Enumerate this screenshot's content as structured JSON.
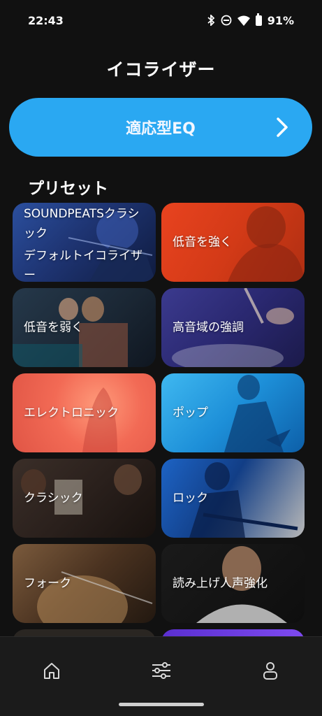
{
  "status_bar": {
    "time": "22:43",
    "battery": "91%",
    "icons": [
      "bluetooth-icon",
      "do-not-disturb-icon",
      "wifi-icon",
      "battery-icon"
    ]
  },
  "header": {
    "title": "イコライザー"
  },
  "adaptive_eq": {
    "label": "適応型EQ",
    "icon": "chevron-right-icon",
    "color": "#2aa8f2"
  },
  "presets": {
    "title": "プリセット",
    "items": [
      {
        "label": "SOUNDPEATSクラシック",
        "sub": "デフォルトイコライザー"
      },
      {
        "label": "低音を強く"
      },
      {
        "label": "低音を弱く"
      },
      {
        "label": "高音域の強調"
      },
      {
        "label": "エレクトロニック"
      },
      {
        "label": "ポップ"
      },
      {
        "label": "クラシック"
      },
      {
        "label": "ロック"
      },
      {
        "label": "フォーク"
      },
      {
        "label": "読み上げ人声強化"
      }
    ]
  },
  "bottom_nav": {
    "items": [
      {
        "icon": "home-icon"
      },
      {
        "icon": "equalizer-sliders-icon"
      },
      {
        "icon": "profile-icon"
      }
    ]
  }
}
